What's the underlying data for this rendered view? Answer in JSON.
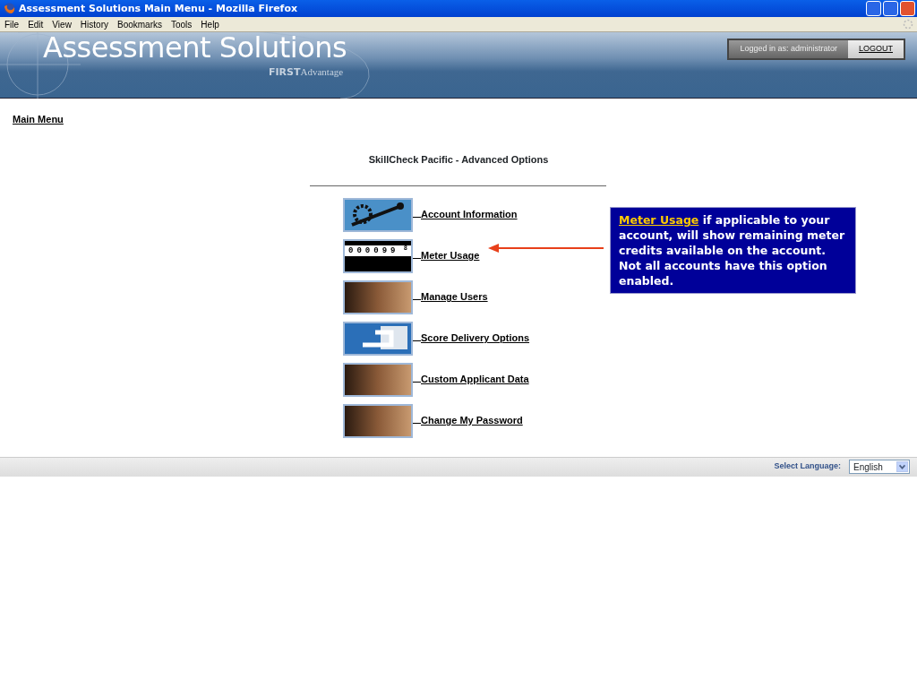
{
  "window": {
    "title": "Assessment Solutions Main Menu - Mozilla Firefox"
  },
  "menu_bar": [
    "File",
    "Edit",
    "View",
    "History",
    "Bookmarks",
    "Tools",
    "Help"
  ],
  "header": {
    "logo": "Assessment Solutions",
    "sub_logo_bold": "FIRST",
    "sub_logo": "Advantage",
    "logged_in": "Logged in as: administrator",
    "logout": "LOGOUT"
  },
  "breadcrumb": "Main Menu",
  "heading": "SkillCheck Pacific - Advanced Options",
  "options": [
    {
      "kind": "gears",
      "label": "Account Information"
    },
    {
      "kind": "meter",
      "label": "Meter Usage",
      "digits": [
        "0",
        "0",
        "0",
        "0",
        "9",
        "9"
      ],
      "last_digit": "8"
    },
    {
      "kind": "photo",
      "label": "Manage Users"
    },
    {
      "kind": "monitor",
      "label": "Score Delivery Options"
    },
    {
      "kind": "photo",
      "label": "Custom Applicant Data"
    },
    {
      "kind": "photo",
      "label": "Change My Password"
    }
  ],
  "callout": {
    "link": "Meter Usage",
    "text": " if applicable to your account, will show remaining meter credits available on the account.  Not all accounts have this option enabled."
  },
  "footer": {
    "label": "Select Language:",
    "language": "English"
  }
}
